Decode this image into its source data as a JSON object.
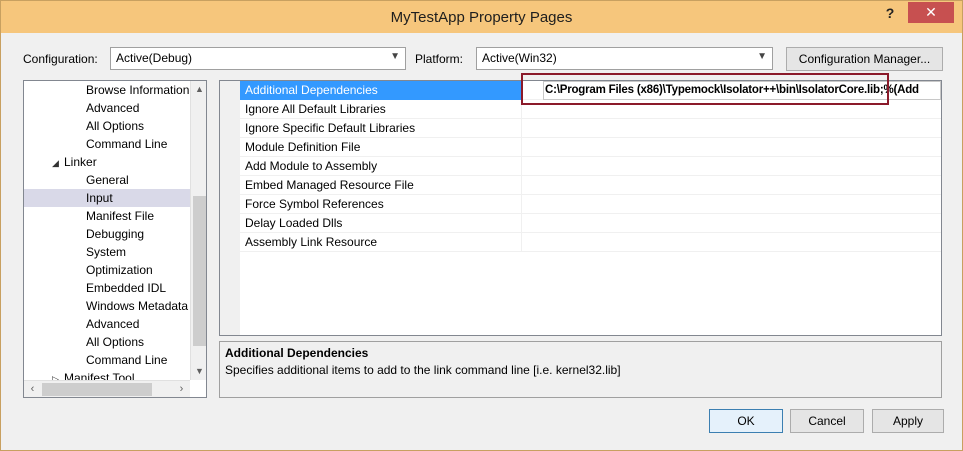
{
  "window": {
    "title": "MyTestApp Property Pages",
    "help": "?",
    "close": "✕"
  },
  "config_label": "Configuration:",
  "config_value": "Active(Debug)",
  "platform_label": "Platform:",
  "platform_value": "Active(Win32)",
  "config_manager_label": "Configuration Manager...",
  "tree": {
    "items": [
      "Browse Information",
      "Advanced",
      "All Options",
      "Command Line",
      "Linker",
      "General",
      "Input",
      "Manifest File",
      "Debugging",
      "System",
      "Optimization",
      "Embedded IDL",
      "Windows Metadata",
      "Advanced",
      "All Options",
      "Command Line",
      "Manifest Tool"
    ],
    "selected": "Input"
  },
  "grid": {
    "rows": [
      {
        "name": "Additional Dependencies",
        "value": "C:\\Program Files (x86)\\Typemock\\Isolator++\\bin\\IsolatorCore.lib;%(Add"
      },
      {
        "name": "Ignore All Default Libraries",
        "value": ""
      },
      {
        "name": "Ignore Specific Default Libraries",
        "value": ""
      },
      {
        "name": "Module Definition File",
        "value": ""
      },
      {
        "name": "Add Module to Assembly",
        "value": ""
      },
      {
        "name": "Embed Managed Resource File",
        "value": ""
      },
      {
        "name": "Force Symbol References",
        "value": ""
      },
      {
        "name": "Delay Loaded Dlls",
        "value": ""
      },
      {
        "name": "Assembly Link Resource",
        "value": ""
      }
    ]
  },
  "description": {
    "title": "Additional Dependencies",
    "text": "Specifies additional items to add to the link command line [i.e. kernel32.lib]"
  },
  "buttons": {
    "ok": "OK",
    "cancel": "Cancel",
    "apply": "Apply"
  },
  "colors": {
    "titlebar": "#f6c67c",
    "selection": "#3399ff",
    "highlight_box": "#8b1a2a"
  }
}
